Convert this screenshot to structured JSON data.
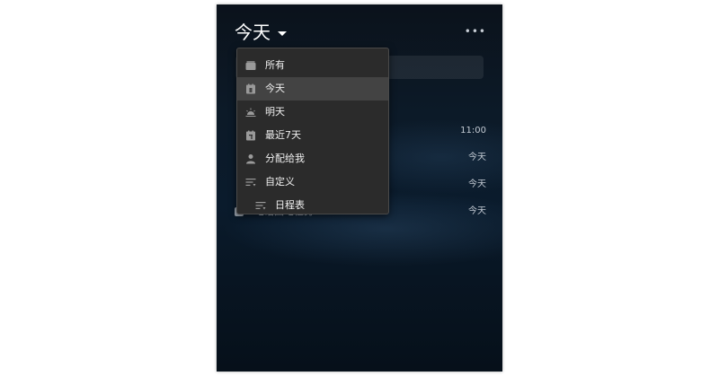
{
  "header": {
    "title": "今天",
    "more_label": "•••"
  },
  "menu": {
    "items": [
      {
        "label": "所有",
        "icon": "inbox-icon"
      },
      {
        "label": "今天",
        "icon": "calendar-today-icon",
        "selected": true
      },
      {
        "label": "明天",
        "icon": "sunrise-icon"
      },
      {
        "label": "最近7天",
        "icon": "calendar-week-icon"
      },
      {
        "label": "分配给我",
        "icon": "person-icon"
      },
      {
        "label": "自定义",
        "icon": "filter-icon"
      },
      {
        "label": "日程表",
        "icon": "filter-icon"
      }
    ]
  },
  "tasks": [
    {
      "time": "11:00",
      "text": ""
    },
    {
      "time": "今天",
      "text": ""
    },
    {
      "time": "今天",
      "text": ""
    },
    {
      "time": "今天",
      "text": "电话回电任务"
    }
  ],
  "colors": {
    "menu_bg": "#2b2b2b",
    "menu_selected": "#434343",
    "title": "#ffffff"
  }
}
